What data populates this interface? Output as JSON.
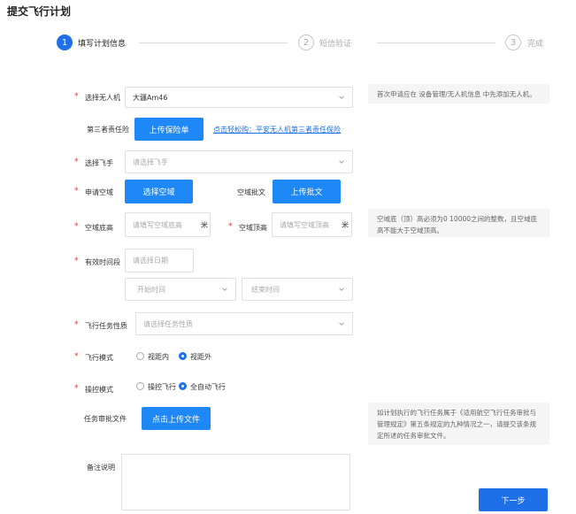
{
  "page_title": "提交飞行计划",
  "steps": [
    {
      "num": "1",
      "label": "填写计划信息"
    },
    {
      "num": "2",
      "label": "短信验证"
    },
    {
      "num": "3",
      "label": "完成"
    }
  ],
  "form": {
    "drone": {
      "label": "选择无人机",
      "value": "大疆Am46"
    },
    "insurance": {
      "label": "第三者责任险",
      "button": "上传保险单",
      "link": "点击轻松购：平安无人机第三者责任保险"
    },
    "pilot": {
      "label": "选择飞手",
      "placeholder": "请选择飞手"
    },
    "airspace": {
      "label": "申请空域",
      "button": "选择空域",
      "approval_label": "空域批文",
      "approval_button": "上传批文"
    },
    "floor": {
      "label": "空域底高",
      "placeholder": "请填写空域底高",
      "unit": "米"
    },
    "ceiling": {
      "label": "空域顶高",
      "placeholder": "请填写空域顶高",
      "unit": "米"
    },
    "period": {
      "label": "有效时间段",
      "date_placeholder": "请选择日期",
      "start_placeholder": "开始时间",
      "end_placeholder": "结束时间"
    },
    "task": {
      "label": "飞行任务性质",
      "placeholder": "请选择任务性质"
    },
    "flight_mode": {
      "label": "飞行模式",
      "options": [
        "视距内",
        "视距外"
      ],
      "selected": 1
    },
    "control_mode": {
      "label": "操控模式",
      "options": [
        "操控飞行",
        "全自动飞行"
      ],
      "selected": 1
    },
    "task_file": {
      "label": "任务审批文件",
      "button": "点击上传文件"
    },
    "remarks": {
      "label": "备注说明"
    }
  },
  "notes": {
    "drone_note": "首次申请应在 设备管理/无人机信息 中先添加无人机。",
    "height_note_line1": "空域底（顶）高必须为0 10000之间的整数，且空域底",
    "height_note_line2": "高不能大于空域顶高。",
    "file_note_line1": "如计划执行的飞行任务属于《适用航空飞行任务审批与",
    "file_note_line2": "管理规定》第五条规定的九种情况之一，请提交该条规",
    "file_note_line3": "定所述的任务审批文件。"
  },
  "next_button": "下一步",
  "colors": {
    "primary": "#1e6fe8",
    "button": "#1e88f7",
    "required": "#e53935"
  }
}
